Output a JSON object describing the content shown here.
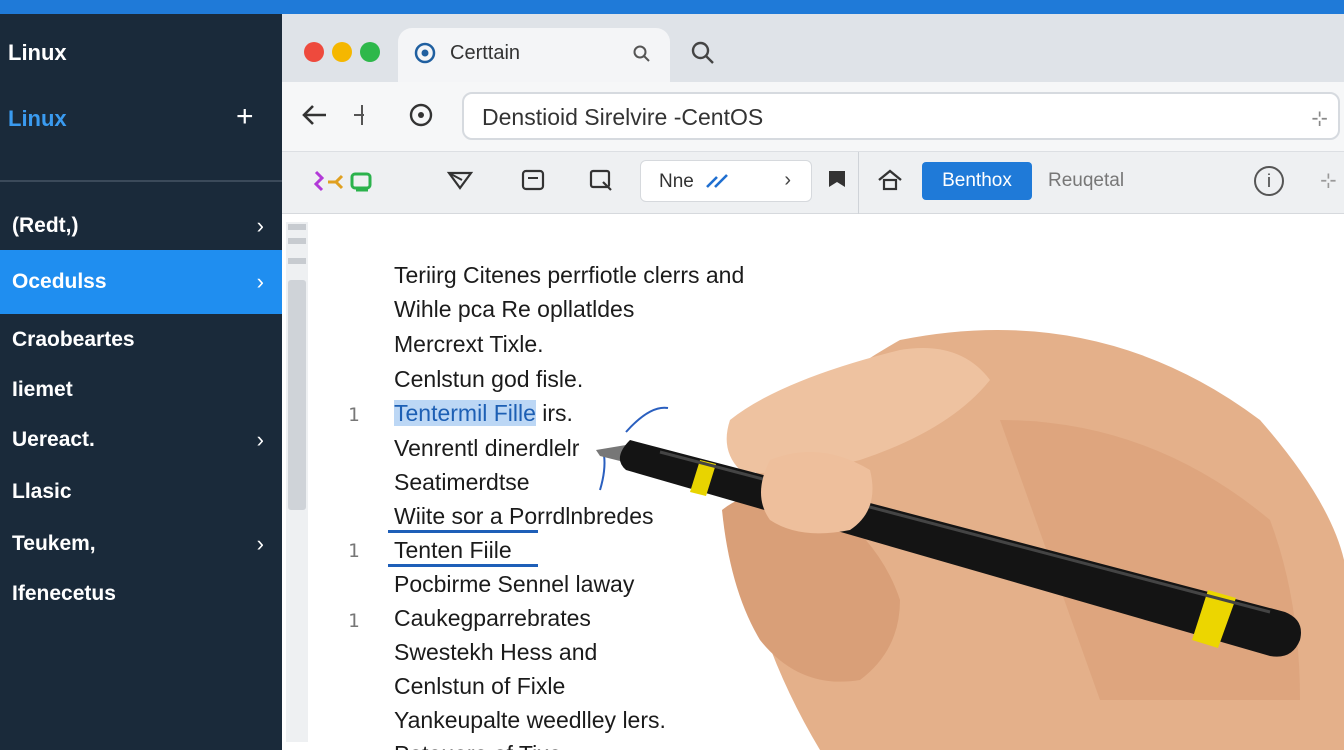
{
  "sidebar": {
    "title": "Linux",
    "subtitle": "Linux",
    "items": [
      {
        "label": "(Redt,)",
        "chevron": "›"
      },
      {
        "label": "Ocedulss",
        "chevron": "›"
      },
      {
        "label": "Craobeartes",
        "chevron": ""
      },
      {
        "label": "Iiemet",
        "chevron": ""
      },
      {
        "label": "Uereact.",
        "chevron": "›"
      },
      {
        "label": "Llasic",
        "chevron": ""
      },
      {
        "label": "Teukem,",
        "chevron": "›"
      },
      {
        "label": "Ifenecetus",
        "chevron": ""
      }
    ],
    "plus": "+"
  },
  "browser": {
    "tab_label": "Certtain",
    "url": "Denstioid Sirelvire -CentOS",
    "url_end": "⊹"
  },
  "toolbar": {
    "box_text": "Nne",
    "box_chevron": "›",
    "primary_button": "Benthox",
    "secondary_link": "Reuqetal",
    "info": "i",
    "end_icon": "⊹"
  },
  "editor": {
    "lines": [
      {
        "num": "",
        "text": "Teriirg Citenes perrfiotle clerrs and"
      },
      {
        "num": "",
        "text": "Wihle pca Re opllatldes"
      },
      {
        "num": "",
        "text": "Mercrext Tixle."
      },
      {
        "num": "",
        "text": "Cenlstun god fisle."
      },
      {
        "num": "1",
        "text": "Tentermil Fille",
        "after": " irs."
      },
      {
        "num": "",
        "text": "Venrentl dinerdlelr"
      },
      {
        "num": "",
        "text": "Seatimerdtse"
      },
      {
        "num": "",
        "text": "Wiite sor a Porrdlnbredes"
      },
      {
        "num": "1",
        "text": "Tenten Fiile"
      },
      {
        "num": "",
        "text": "Pocbirme Sennel laway"
      },
      {
        "num": "1",
        "text": "Caukegparrebrates"
      },
      {
        "num": "",
        "text": "Swestekh Hess and"
      },
      {
        "num": "",
        "text": "Cenlstun of Fixle"
      },
      {
        "num": "",
        "text": "Yankeupalte weedlley lers."
      },
      {
        "num": "",
        "text": "Poteuere of Tixe"
      }
    ]
  },
  "colors": {
    "accent": "#1f8ef0",
    "sidebar_bg": "#1a2a3a",
    "highlight": "#bcd7f5"
  }
}
